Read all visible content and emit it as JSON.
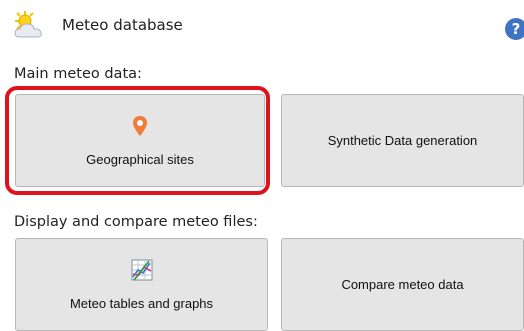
{
  "header": {
    "title": "Meteo database",
    "icon": "weather-sun-cloud-icon",
    "help": "?",
    "help_icon": "help-icon"
  },
  "sections": {
    "main_label": "Main meteo data:",
    "display_label": "Display and compare meteo files:"
  },
  "tiles": {
    "geo_sites": {
      "label": "Geographical sites",
      "icon": "location-pin-icon"
    },
    "synthetic": {
      "label": "Synthetic Data generation"
    },
    "tables_graphs": {
      "label": "Meteo tables and graphs",
      "icon": "chart-table-icon"
    },
    "compare": {
      "label": "Compare meteo data"
    }
  },
  "colors": {
    "highlight": "#e0121b",
    "tile_bg": "#e5e5e5",
    "pin": "#f07b3a",
    "help": "#3f74c4"
  }
}
